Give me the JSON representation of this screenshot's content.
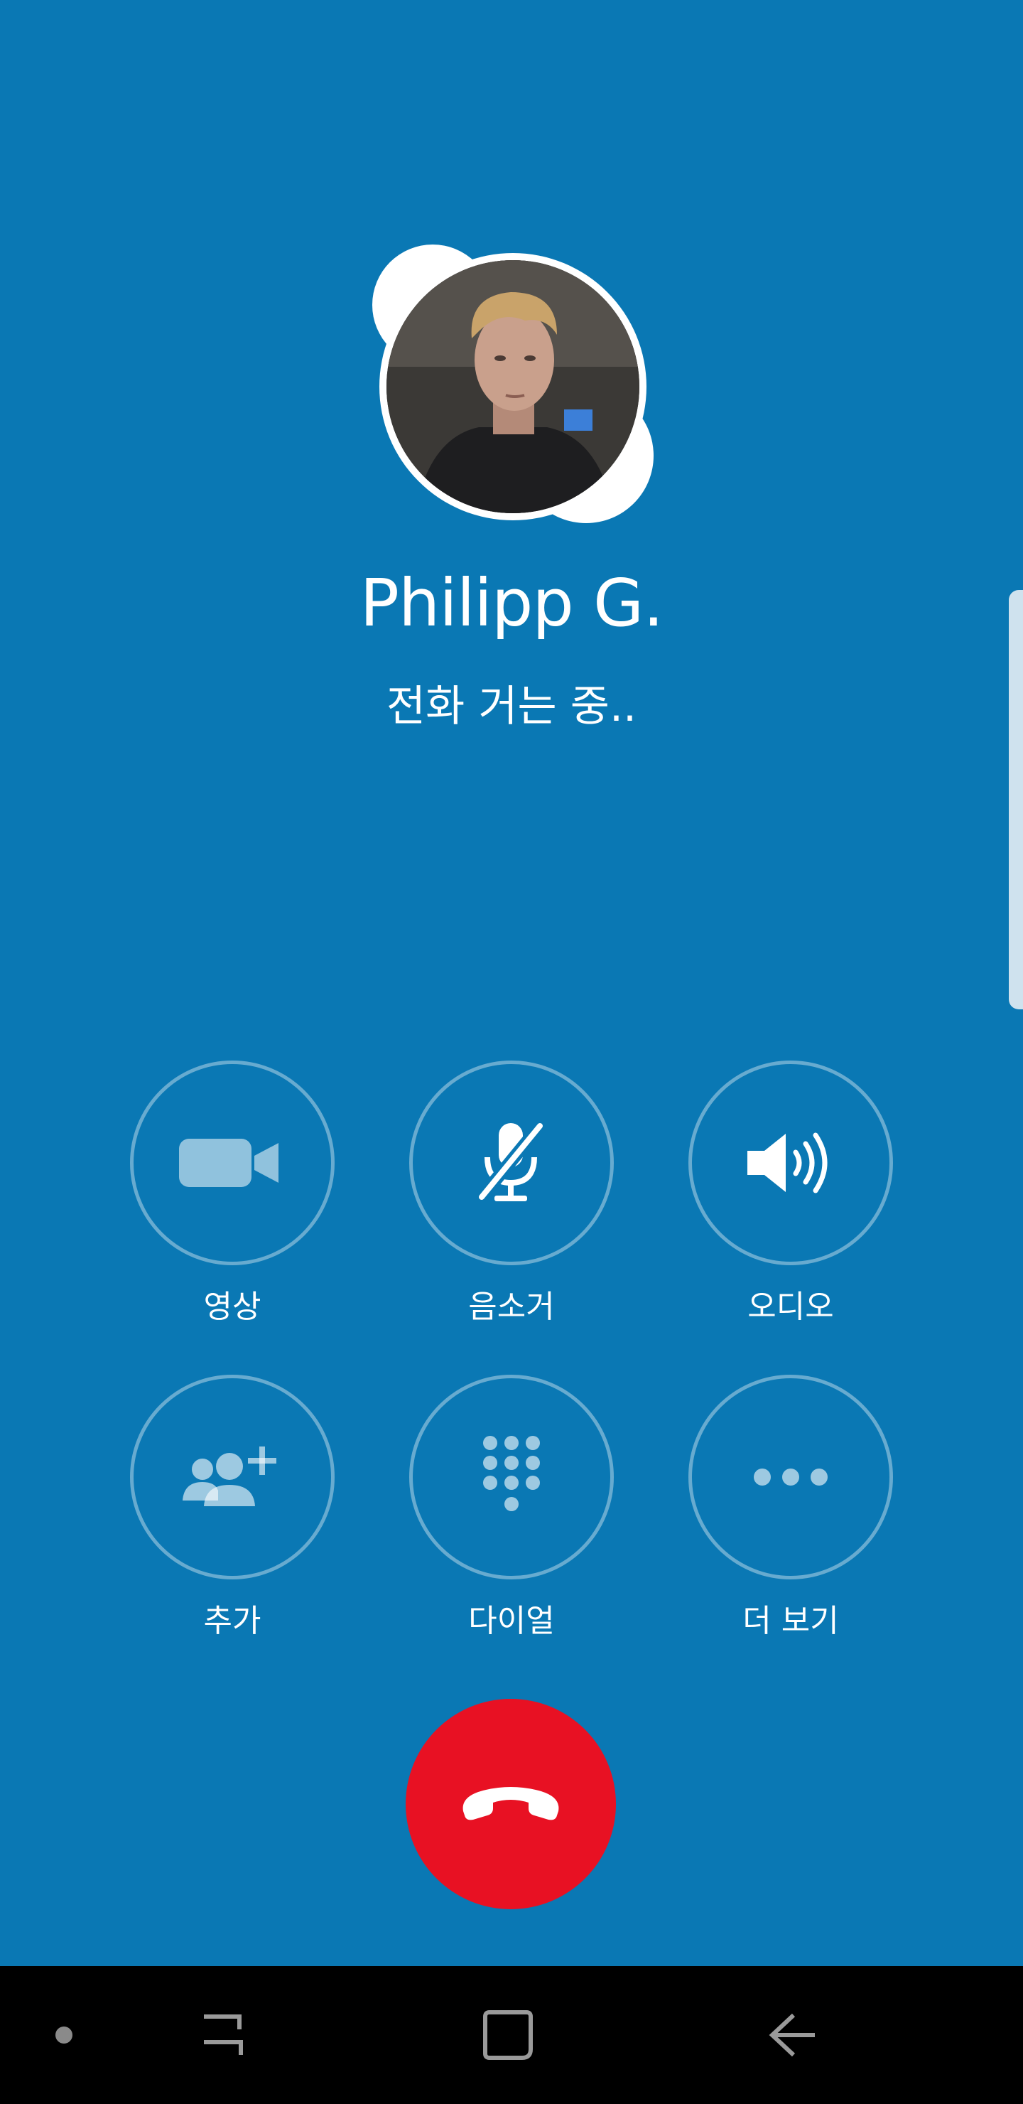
{
  "caller": {
    "name": "Philipp G.",
    "status": "전화 거는 중.."
  },
  "controls": [
    {
      "label": "영상",
      "icon": "video-camera-icon"
    },
    {
      "label": "음소거",
      "icon": "microphone-muted-icon"
    },
    {
      "label": "오디오",
      "icon": "speaker-icon"
    },
    {
      "label": "추가",
      "icon": "add-people-icon"
    },
    {
      "label": "다이얼",
      "icon": "dialpad-icon"
    },
    {
      "label": "더 보기",
      "icon": "more-dots-icon"
    }
  ],
  "end_call": {
    "icon": "hang-up-phone-icon"
  },
  "navbar": {
    "items": [
      "dot-icon",
      "recent-apps-icon",
      "home-icon",
      "back-icon"
    ]
  },
  "colors": {
    "background": "#0a78b4",
    "end_call": "#e81123",
    "navbar": "#000000"
  }
}
